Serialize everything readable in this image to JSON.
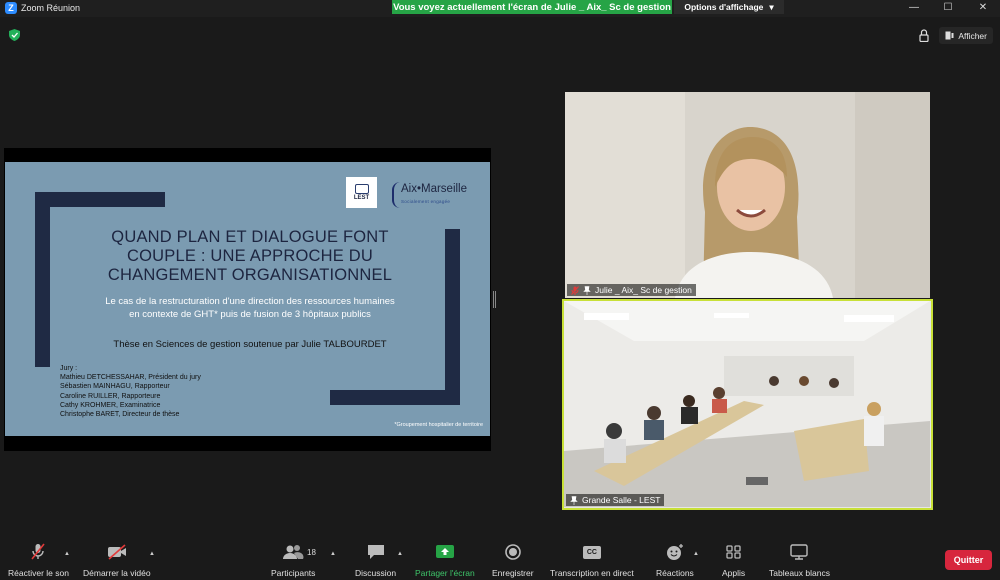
{
  "window": {
    "app_title": "Zoom Réunion",
    "share_banner": "Vous voyez actuellement l'écran de Julie _ Aix_ Sc de gestion",
    "view_options_label": "Options d'affichage",
    "view_options_chevron": "▾",
    "minimize_glyph": "—",
    "maximize_glyph": "☐",
    "close_glyph": "✕"
  },
  "top_right": {
    "afficher_label": "Afficher"
  },
  "slide": {
    "title": "QUAND PLAN ET DIALOGUE FONT COUPLE : UNE APPROCHE DU CHANGEMENT ORGANISATIONNEL",
    "subtitle": "Le cas de la restructuration d'une direction des ressources humaines en contexte de GHT* puis de fusion de 3 hôpitaux publics",
    "thesis": "Thèse en Sciences de gestion soutenue par Julie TALBOURDET",
    "jury_heading": "Jury :",
    "jury": [
      "Mathieu DETCHESSAHAR, Président du jury",
      "Sébastien MAINHAGU, Rapporteur",
      "Caroline RUILLER, Rapporteure",
      "Cathy KROHMER, Examinatrice",
      "Christophe BARET, Directeur de thèse"
    ],
    "footnote": "*Groupement hospitalier de territoire",
    "logo_lest": "LEST",
    "logo_amu_name": "Aix•Marseille",
    "logo_amu_tagline": "Socialement engagée"
  },
  "videos": {
    "julie_name": "Julie _ Aix_ Sc de gestion",
    "salle_name": "Grande Salle - LEST"
  },
  "toolbar": {
    "mute_label": "Réactiver le son",
    "video_label": "Démarrer la vidéo",
    "participants_label": "Participants",
    "participants_count": "18",
    "discussion_label": "Discussion",
    "share_label": "Partager l'écran",
    "record_label": "Enregistrer",
    "transcription_label": "Transcription en direct",
    "reactions_label": "Réactions",
    "apps_label": "Applis",
    "whiteboards_label": "Tableaux blancs",
    "quit_label": "Quitter",
    "cc_text": "CC"
  },
  "colors": {
    "accent_green": "#26a446",
    "active_speaker_border": "#c8e038",
    "quit_red": "#d7263d",
    "slide_bg": "#7b9bb1",
    "slide_frame": "#1f2a44"
  }
}
